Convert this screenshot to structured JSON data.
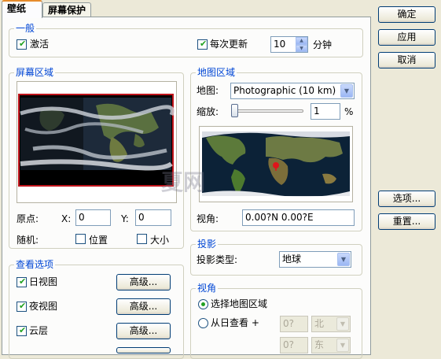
{
  "tabs": [
    {
      "label": "壁纸"
    },
    {
      "label": "屏幕保护"
    }
  ],
  "side_buttons": {
    "ok": "确定",
    "apply": "应用",
    "cancel": "取消",
    "options": "选项...",
    "reset": "重置..."
  },
  "general": {
    "title": "一般",
    "activate_label": "激活",
    "activate_checked": true,
    "update_each_label": "每次更新",
    "update_each_checked": true,
    "interval_value": "10",
    "interval_unit": "分钟"
  },
  "screen_area": {
    "title": "屏幕区域",
    "origin_label": "原点:",
    "x_label": "X:",
    "x_value": "0",
    "y_label": "Y:",
    "y_value": "0",
    "random_label": "随机:",
    "position_label": "位置",
    "position_checked": false,
    "size_label": "大小",
    "size_checked": false
  },
  "view_options": {
    "title": "查看选项",
    "items": [
      {
        "label": "日视图",
        "checked": true,
        "button": "高级..."
      },
      {
        "label": "夜视图",
        "checked": true,
        "button": "高级..."
      },
      {
        "label": "云层",
        "checked": true,
        "button": "高级..."
      }
    ]
  },
  "map_area": {
    "title": "地图区域",
    "map_label": "地图:",
    "map_value": "Photographic (10 km)",
    "zoom_label": "缩放:",
    "zoom_value": "1",
    "zoom_unit": "%",
    "zoom_fraction": 0.01,
    "viewpoint_label": "视角:",
    "viewpoint_value": "0.00?N   0.00?E"
  },
  "projection": {
    "title": "投影",
    "type_label": "投影类型:",
    "type_value": "地球"
  },
  "viewpoint": {
    "title": "视角",
    "choose_map_label": "选择地图区域",
    "choose_map_selected": true,
    "from_sun_label": "从日查看 +",
    "from_sun_selected": false,
    "lat_value": "0?",
    "lat_dir": "北",
    "lon_value": "0?",
    "lon_dir": "东"
  },
  "watermark": {
    "text": "夏网"
  },
  "colors": {
    "group_title": "#0046d5",
    "tab_accent": "#e68b2c",
    "check": "#21a121"
  }
}
